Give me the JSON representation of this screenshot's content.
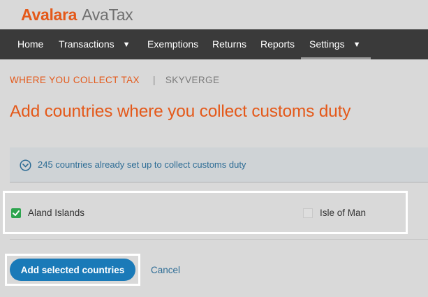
{
  "logo": {
    "brand": "Avalara",
    "product": "AvaTax",
    "brand_color": "#e4591a"
  },
  "nav": {
    "items": [
      {
        "label": "Home",
        "has_dropdown": false,
        "active": false
      },
      {
        "label": "Transactions",
        "has_dropdown": true,
        "active": false
      },
      {
        "label": "Exemptions",
        "has_dropdown": false,
        "active": false
      },
      {
        "label": "Returns",
        "has_dropdown": false,
        "active": false
      },
      {
        "label": "Reports",
        "has_dropdown": false,
        "active": false
      },
      {
        "label": "Settings",
        "has_dropdown": true,
        "active": true
      }
    ],
    "dropdown_icon": "caret-down-icon"
  },
  "breadcrumb": {
    "current": "WHERE YOU COLLECT TAX",
    "separator": "|",
    "company": "SKYVERGE"
  },
  "page_title": "Add countries where you collect customs duty",
  "accordion": {
    "icon": "chevron-down-circle-icon",
    "text": "245 countries already set up to collect customs duty",
    "expanded": false
  },
  "countries": [
    {
      "label": "Aland Islands",
      "checked": true
    },
    {
      "label": "Isle of Man",
      "checked": false
    }
  ],
  "actions": {
    "primary_label": "Add selected countries",
    "cancel_label": "Cancel"
  },
  "colors": {
    "accent": "#e4591a",
    "primary_button": "#1a7ab8",
    "link": "#2d6c95",
    "checkbox_checked": "#2da44e",
    "nav_background": "#3a3a3a"
  }
}
